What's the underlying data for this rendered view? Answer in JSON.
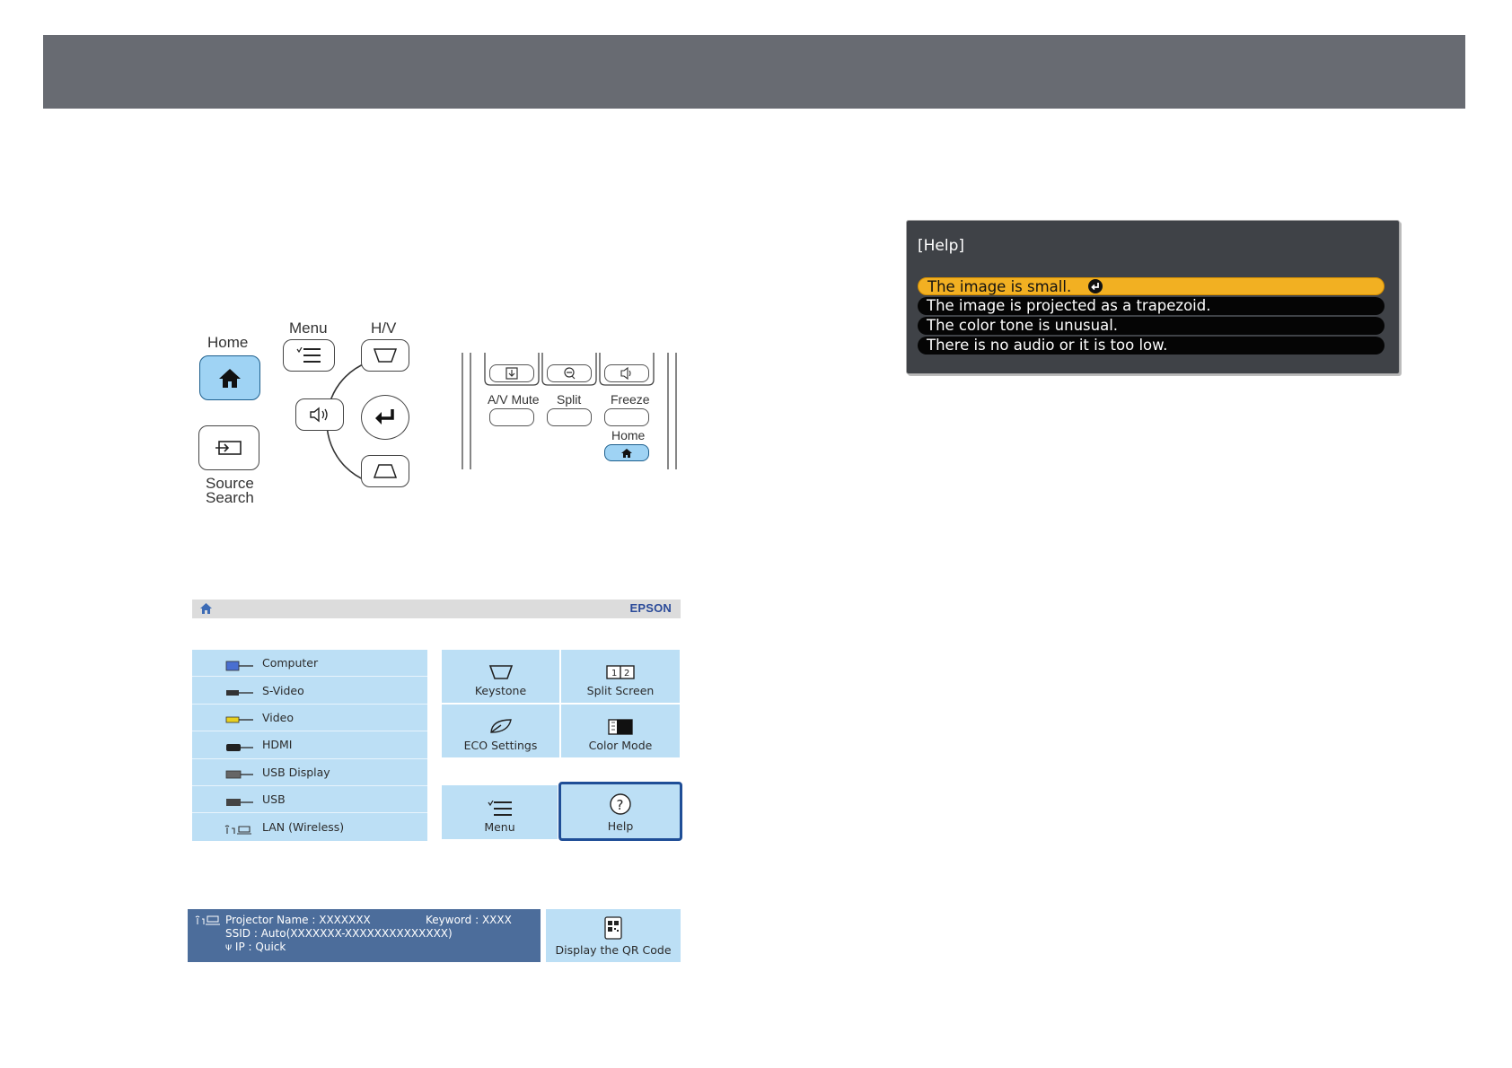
{
  "remote_panel": {
    "home_label": "Home",
    "menu_label": "Menu",
    "hv_label": "H/V",
    "source_label_1": "Source",
    "source_label_2": "Search"
  },
  "remote_control": {
    "av_mute_label": "A/V Mute",
    "split_label": "Split",
    "freeze_label": "Freeze",
    "home_label": "Home"
  },
  "home_screen": {
    "brand": "EPSON",
    "sources": [
      {
        "label": "Computer",
        "icon": "computer-port-icon"
      },
      {
        "label": "S-Video",
        "icon": "svideo-port-icon"
      },
      {
        "label": "Video",
        "icon": "video-port-icon"
      },
      {
        "label": "HDMI",
        "icon": "hdmi-port-icon"
      },
      {
        "label": "USB Display",
        "icon": "usb-display-port-icon"
      },
      {
        "label": "USB",
        "icon": "usb-port-icon"
      },
      {
        "label": "LAN (Wireless)",
        "icon": "lan-wireless-icon"
      }
    ],
    "tiles": {
      "keystone": "Keystone",
      "split_screen": "Split Screen",
      "eco": "ECO Settings",
      "color_mode": "Color Mode",
      "menu": "Menu",
      "help": "Help"
    },
    "network_info": {
      "projector_name_label": "Projector Name :",
      "projector_name_value": "XXXXXXX",
      "keyword_label": "Keyword :",
      "keyword_value": "XXXX",
      "ssid_label": "SSID :",
      "ssid_value": "Auto(XXXXXXX-XXXXXXXXXXXXXX)",
      "ip_label": "IP :",
      "ip_value": "Quick"
    },
    "qr_label": "Display the QR Code"
  },
  "help_dialog": {
    "title": "[Help]",
    "items": [
      "The image is small.",
      "The image is projected as a trapezoid.",
      "The color tone is unusual.",
      "There is no audio or it is too low."
    ],
    "selected_index": 0
  },
  "colors": {
    "top_bar": "#686b72",
    "tile_blue": "#bcdff5",
    "home_key": "#9fd3f4",
    "selected_item": "#f2b022",
    "info_bar": "#4c6d9b"
  }
}
